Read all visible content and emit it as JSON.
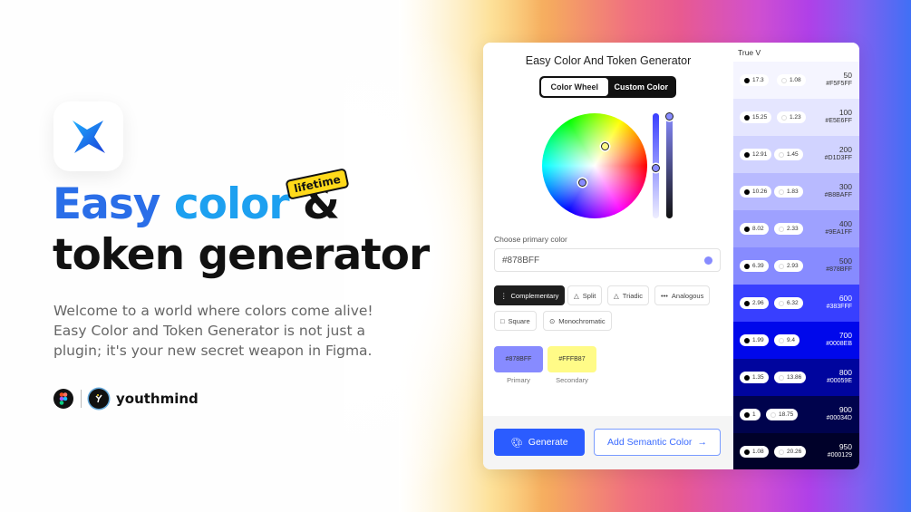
{
  "hero": {
    "headline_word1": "Easy",
    "headline_word2": "color",
    "headline_amp": "&",
    "headline_line2": "token generator",
    "badge": "lifetime",
    "description": "Welcome to a world where colors come alive! Easy Color and Token Generator is not just a plugin; it's your new secret weapon in Figma.",
    "brand_name": "youthmind",
    "icons": [
      "app-star-icon",
      "figma-icon",
      "youthmind-logo-icon"
    ]
  },
  "plugin": {
    "title": "Easy Color And Token Generator",
    "tabs": [
      {
        "label": "Color Wheel",
        "active": true
      },
      {
        "label": "Custom Color",
        "active": false
      }
    ],
    "primary_label": "Choose primary color",
    "primary_value": "#878BFF",
    "harmonies": [
      {
        "label": "Complementary",
        "icon": "complementary-icon",
        "active": true
      },
      {
        "label": "Split",
        "icon": "split-icon",
        "active": false
      },
      {
        "label": "Triadic",
        "icon": "triadic-icon",
        "active": false
      },
      {
        "label": "Analogous",
        "icon": "analogous-icon",
        "active": false
      },
      {
        "label": "Square",
        "icon": "square-icon",
        "active": false
      },
      {
        "label": "Monochromatic",
        "icon": "monochromatic-icon",
        "active": false
      }
    ],
    "swatches": [
      {
        "hex": "#878BFF",
        "label": "Primary",
        "color": "#878bff"
      },
      {
        "hex": "#FFFB87",
        "label": "Secondary",
        "color": "#fffb87"
      }
    ],
    "generate_label": "Generate",
    "semantic_label": "Add Semantic Color",
    "shades_header": "True V",
    "shades": [
      {
        "name": "50",
        "hex": "#F5F5FF",
        "black": "17.3",
        "white": "1.08",
        "bg": "#f5f5ff",
        "fg": "#333"
      },
      {
        "name": "100",
        "hex": "#E5E6FF",
        "black": "15.25",
        "white": "1.23",
        "bg": "#e5e6ff",
        "fg": "#333"
      },
      {
        "name": "200",
        "hex": "#D1D3FF",
        "black": "12.91",
        "white": "1.45",
        "bg": "#d1d3ff",
        "fg": "#333"
      },
      {
        "name": "300",
        "hex": "#B8BAFF",
        "black": "10.26",
        "white": "1.83",
        "bg": "#b8baff",
        "fg": "#333"
      },
      {
        "name": "400",
        "hex": "#9EA1FF",
        "black": "8.02",
        "white": "2.33",
        "bg": "#9ea1ff",
        "fg": "#333"
      },
      {
        "name": "500",
        "hex": "#878BFF",
        "black": "6.39",
        "white": "2.93",
        "bg": "#878bff",
        "fg": "#333"
      },
      {
        "name": "600",
        "hex": "#383FFF",
        "black": "2.96",
        "white": "6.32",
        "bg": "#383fff",
        "fg": "#fff"
      },
      {
        "name": "700",
        "hex": "#0008EB",
        "black": "1.99",
        "white": "9.4",
        "bg": "#0008eb",
        "fg": "#fff"
      },
      {
        "name": "800",
        "hex": "#00059E",
        "black": "1.35",
        "white": "13.86",
        "bg": "#00059e",
        "fg": "#fff"
      },
      {
        "name": "900",
        "hex": "#00034D",
        "black": "1",
        "white": "18.75",
        "bg": "#00034d",
        "fg": "#fff"
      },
      {
        "name": "950",
        "hex": "#000129",
        "black": "1.08",
        "white": "20.26",
        "bg": "#000129",
        "fg": "#fff"
      }
    ]
  }
}
